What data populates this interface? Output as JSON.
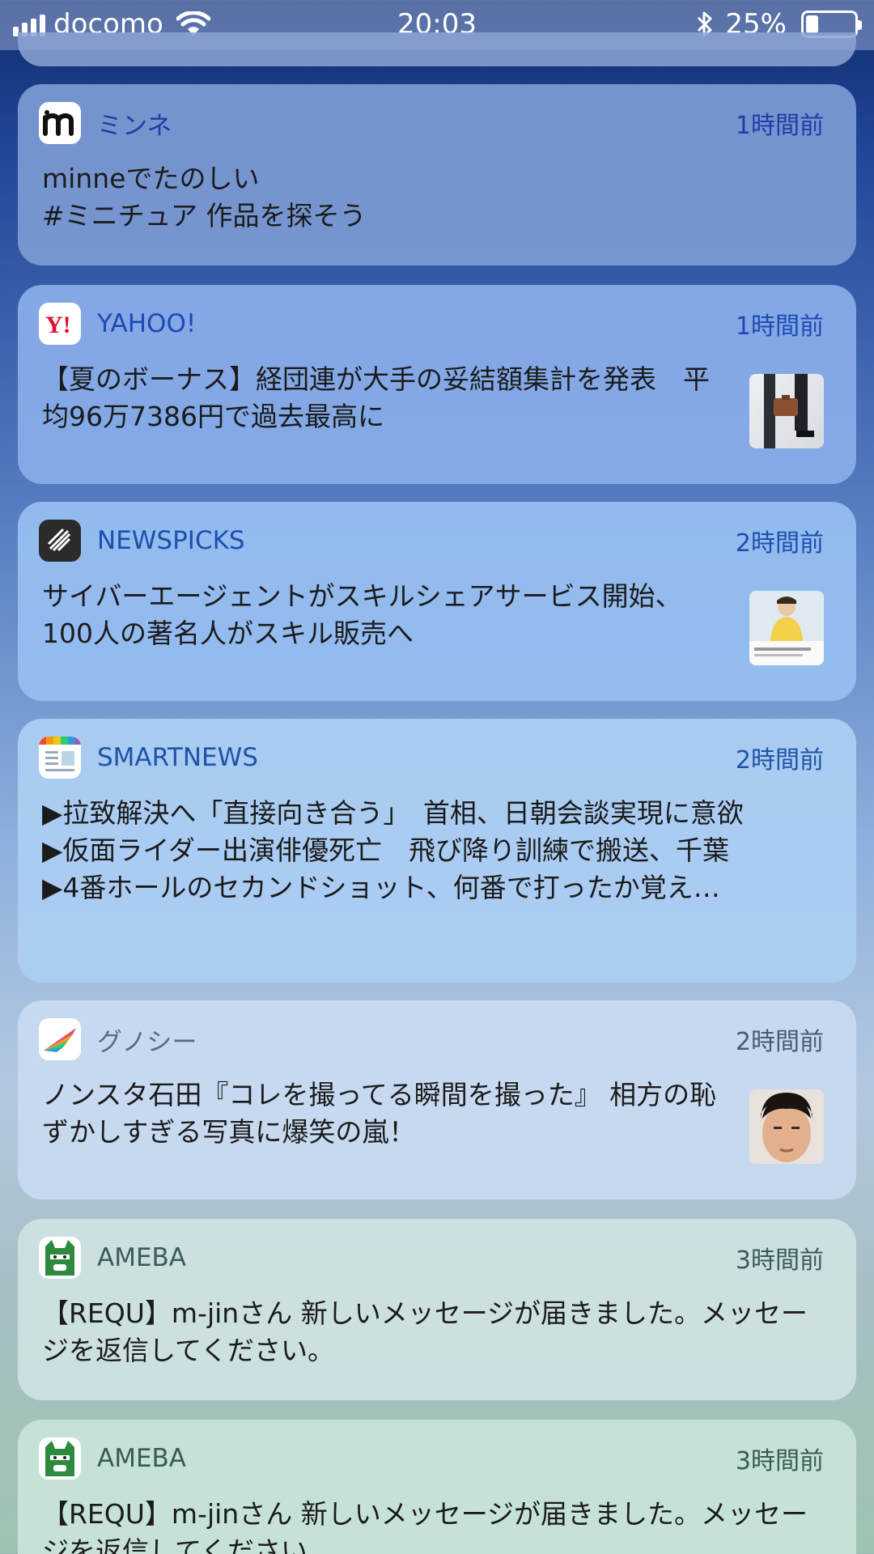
{
  "status_bar": {
    "carrier": "docomo",
    "time": "20:03",
    "battery_percent_label": "25%",
    "battery_level": 0.25
  },
  "notifications": [
    {
      "app": "ミンネ",
      "time": "1時間前",
      "text": "minneでたのしい\n#ミニチュア 作品を探そう",
      "icon": "minne-icon",
      "thumbnail": null
    },
    {
      "app": "YAHOO!",
      "time": "1時間前",
      "text": "【夏のボーナス】経団連が大手の妥結額集計を発表　平均96万7386円で過去最高に",
      "icon": "yahoo-icon",
      "thumbnail": "businessman-thumbnail"
    },
    {
      "app": "NEWSPICKS",
      "time": "2時間前",
      "text": "サイバーエージェントがスキルシェアサービス開始、100人の著名人がスキル販売へ",
      "icon": "newspicks-icon",
      "thumbnail": "person-thumbnail"
    },
    {
      "app": "SMARTNEWS",
      "time": "2時間前",
      "text": "▶拉致解決へ「直接向き合う」　首相、日朝会談実現に意欲\n▶仮面ライダー出演俳優死亡　飛び降り訓練で搬送、千葉\n▶4番ホールのセカンドショット、何番で打ったか覚え…",
      "icon": "smartnews-icon",
      "thumbnail": null
    },
    {
      "app": "グノシー",
      "time": "2時間前",
      "text": "ノンスタ石田『コレを撮ってる瞬間を撮った』 相方の恥ずかしすぎる写真に爆笑の嵐！",
      "icon": "gunosy-icon",
      "thumbnail": "face-thumbnail"
    },
    {
      "app": "AMEBA",
      "time": "3時間前",
      "text": "【REQU】m-jinさん 新しいメッセージが届きました。メッセージを返信してください。",
      "icon": "ameba-icon",
      "thumbnail": null
    },
    {
      "app": "AMEBA",
      "time": "3時間前",
      "text": "【REQU】m-jinさん 新しいメッセージが届きました。メッセージを返信してください。",
      "icon": "ameba-icon",
      "thumbnail": null
    }
  ]
}
